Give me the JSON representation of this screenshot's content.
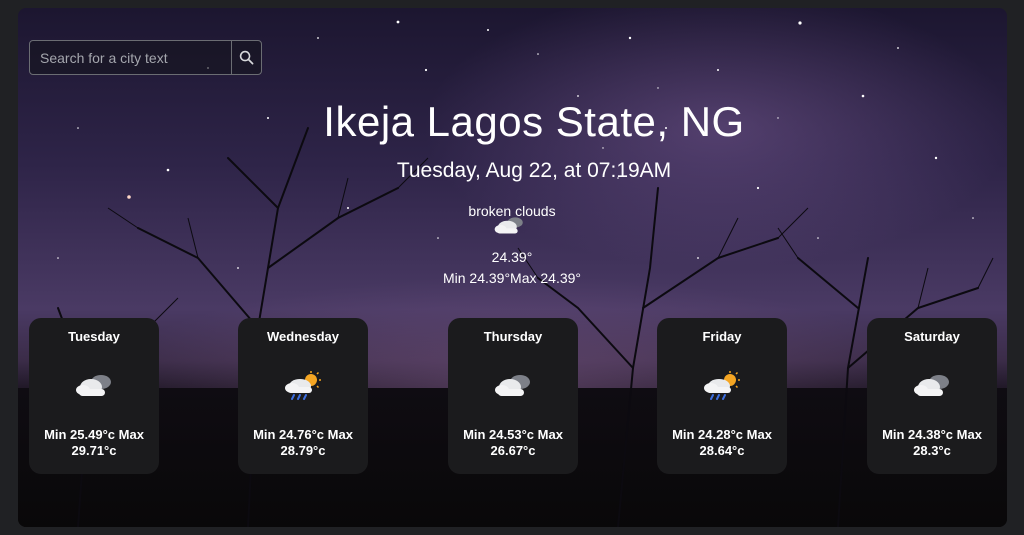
{
  "search": {
    "placeholder": "Search for a city text",
    "button_icon": "search-icon"
  },
  "location": {
    "city": "Ikeja Lagos State, NG"
  },
  "current": {
    "datetime": "Tuesday, Aug 22, at 07:19AM",
    "description": "broken clouds",
    "icon": "broken-clouds-icon",
    "temp": "24.39°",
    "minmax": "Min 24.39°Max 24.39°"
  },
  "forecast": [
    {
      "day": "Tuesday",
      "icon": "broken-clouds-icon",
      "range": "Min 25.49°c Max 29.71°c"
    },
    {
      "day": "Wednesday",
      "icon": "rain-sun-icon",
      "range": "Min 24.76°c Max 28.79°c"
    },
    {
      "day": "Thursday",
      "icon": "broken-clouds-icon",
      "range": "Min 24.53°c Max 26.67°c"
    },
    {
      "day": "Friday",
      "icon": "rain-sun-icon",
      "range": "Min 24.28°c Max 28.64°c"
    },
    {
      "day": "Saturday",
      "icon": "broken-clouds-icon",
      "range": "Min 24.38°c Max 28.3°c"
    }
  ]
}
